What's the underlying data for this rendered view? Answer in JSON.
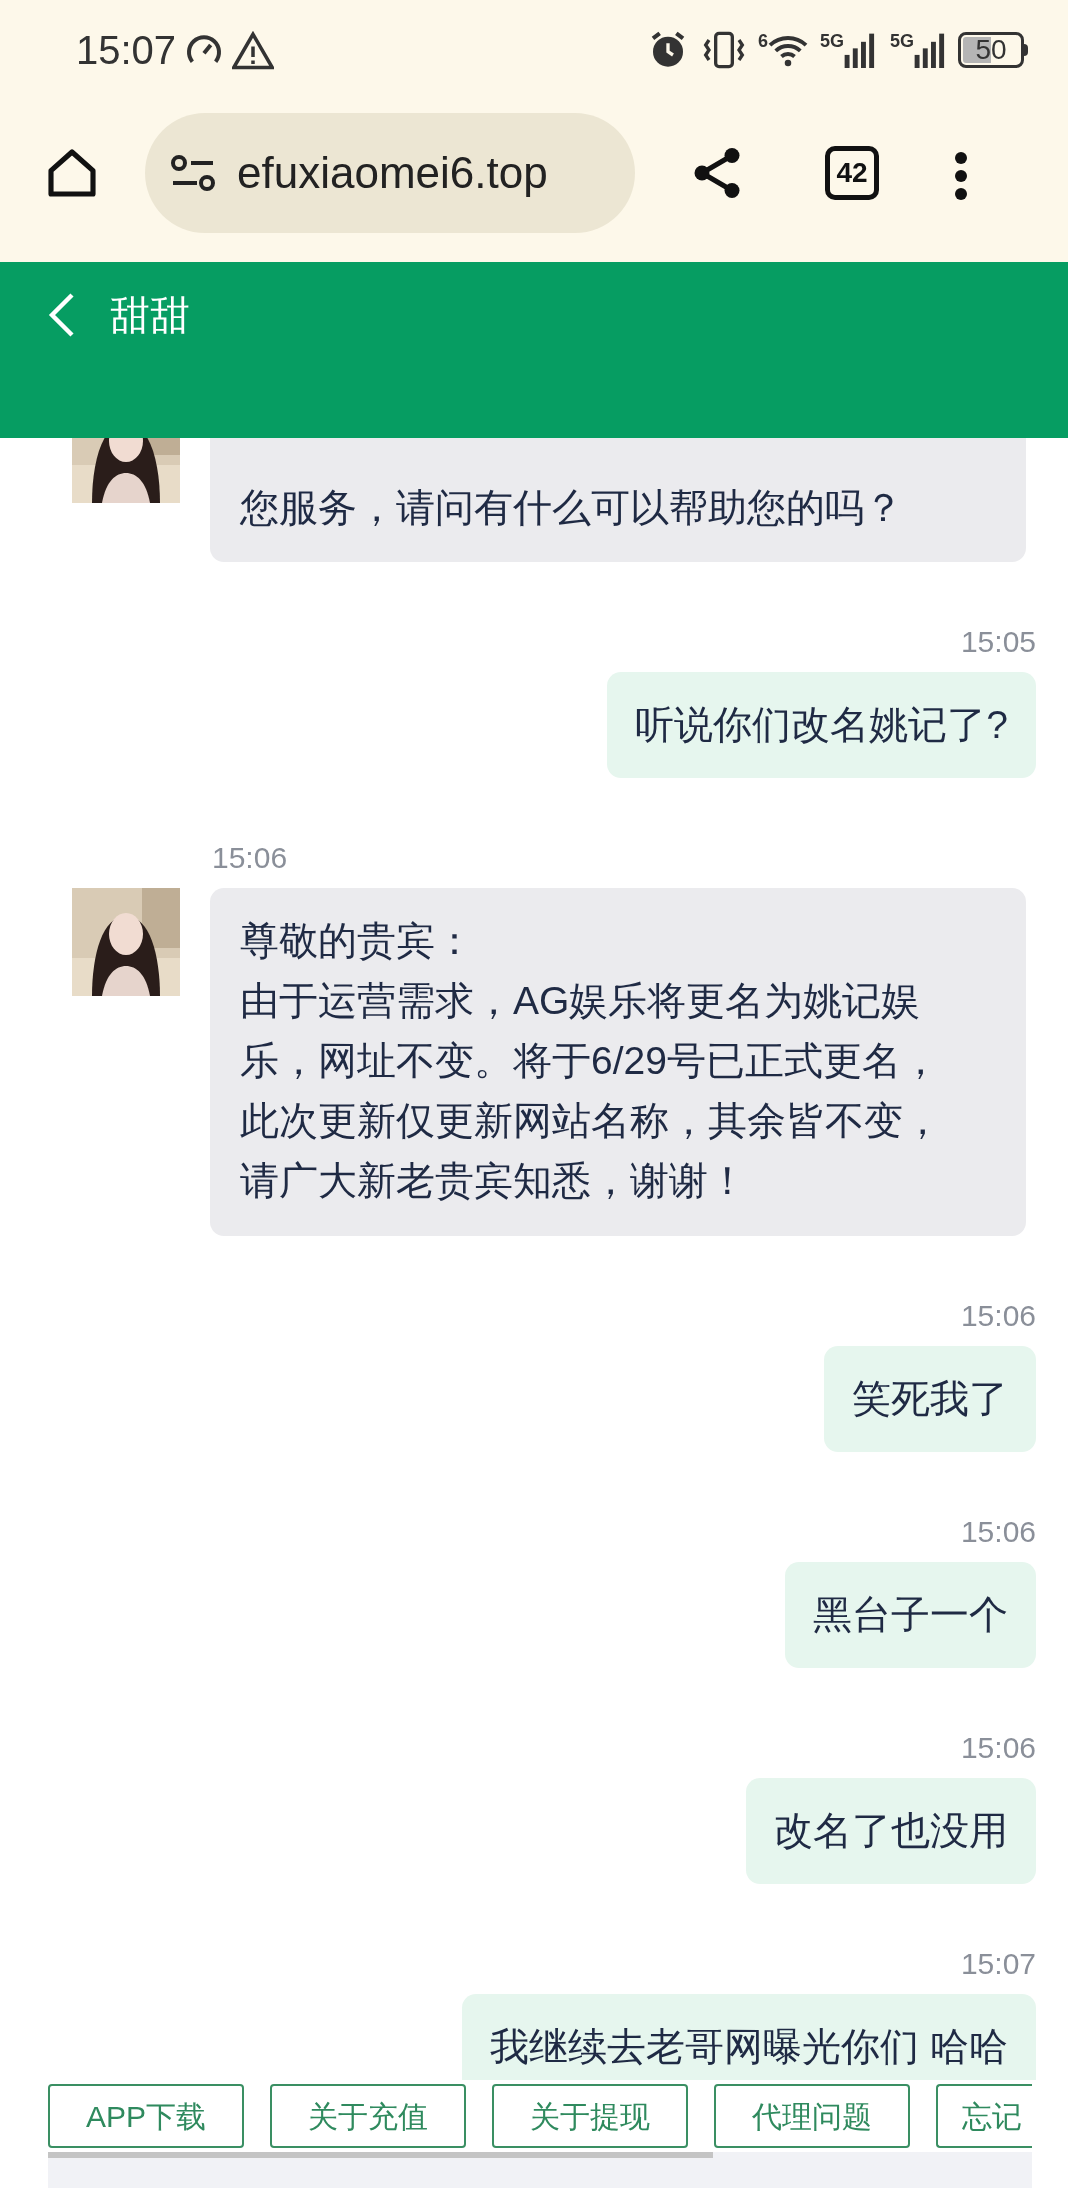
{
  "status_bar": {
    "time": "15:07",
    "wifi_label": "6",
    "signal_labels": [
      "5G",
      "5G"
    ],
    "battery": "50"
  },
  "browser": {
    "url": "efuxiaomei6.top",
    "tab_count": "42"
  },
  "header": {
    "title": "甜甜"
  },
  "messages": [
    {
      "kind": "incoming",
      "text": "您服务，请问有什么可以帮助您的吗？"
    },
    {
      "kind": "outgoing",
      "time": "15:05",
      "text": "听说你们改名姚记了?"
    },
    {
      "kind": "incoming",
      "time": "15:06",
      "greeting": "尊敬的贵宾：",
      "text": "由于运营需求，AG娱乐将更名为姚记娱乐，网址不变。将于6/29号已正式更名，此次更新仅更新网站名称，其余皆不变，请广大新老贵宾知悉，谢谢！"
    },
    {
      "kind": "outgoing",
      "time": "15:06",
      "text": "笑死我了"
    },
    {
      "kind": "outgoing",
      "time": "15:06",
      "text": "黑台子一个"
    },
    {
      "kind": "outgoing",
      "time": "15:06",
      "text": "改名了也没用"
    },
    {
      "kind": "outgoing",
      "time": "15:07",
      "text": "我继续去老哥网曝光你们 哈哈"
    }
  ],
  "quick_replies": [
    "APP下载",
    "关于充值",
    "关于提现",
    "代理问题",
    "忘记"
  ]
}
